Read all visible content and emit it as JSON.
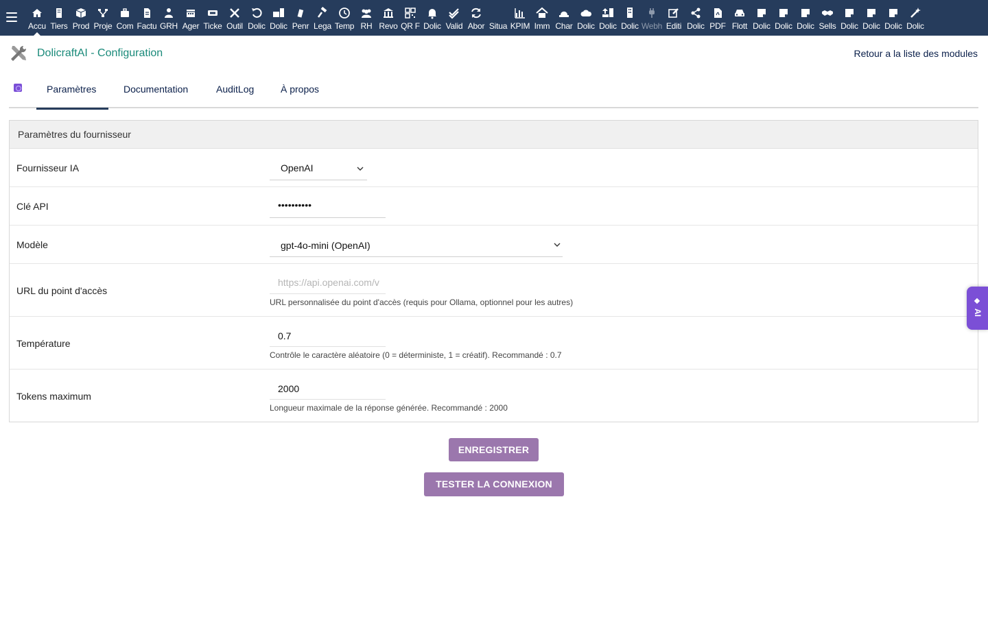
{
  "topbar": {
    "items": [
      {
        "label": "Accu",
        "icon": "home-icon"
      },
      {
        "label": "Tiers",
        "icon": "building-icon"
      },
      {
        "label": "Prod",
        "icon": "cube-icon"
      },
      {
        "label": "Proje",
        "icon": "sitemap-icon"
      },
      {
        "label": "Com",
        "icon": "briefcase-icon"
      },
      {
        "label": "Factu",
        "icon": "invoice-icon"
      },
      {
        "label": "GRH",
        "icon": "users-icon"
      },
      {
        "label": "Ager",
        "icon": "calendar-icon"
      },
      {
        "label": "Ticke",
        "icon": "ticket-icon"
      },
      {
        "label": "Outil",
        "icon": "tools-icon"
      },
      {
        "label": "Dolic",
        "icon": "undo-icon"
      },
      {
        "label": "Dolic",
        "icon": "case-icon"
      },
      {
        "label": "Penr",
        "icon": "note-icon"
      },
      {
        "label": "Lega",
        "icon": "gavel-icon"
      },
      {
        "label": "Temp",
        "icon": "clock-icon"
      },
      {
        "label": "RH",
        "icon": "people-icon"
      },
      {
        "label": "Revo",
        "icon": "bank-icon"
      },
      {
        "label": "QR F",
        "icon": "qrcode-icon"
      },
      {
        "label": "Dolic",
        "icon": "bell-icon"
      },
      {
        "label": "Valid",
        "icon": "check-double-icon"
      },
      {
        "label": "Abor",
        "icon": "sync-icon"
      },
      {
        "label": "Situa",
        "icon": "blank-icon"
      },
      {
        "label": "KPIM",
        "icon": "chart-icon"
      },
      {
        "label": "Imm",
        "icon": "house-icon"
      },
      {
        "label": "Char",
        "icon": "hat-icon"
      },
      {
        "label": "Dolic",
        "icon": "cloud-icon"
      },
      {
        "label": "Dolic",
        "icon": "upload-icon"
      },
      {
        "label": "Dolic",
        "icon": "tower-icon"
      },
      {
        "label": "Webh",
        "icon": "plug-icon"
      },
      {
        "label": "Editi",
        "icon": "edit-icon"
      },
      {
        "label": "Dolic",
        "icon": "share-icon"
      },
      {
        "label": "PDF",
        "icon": "pdf-icon"
      },
      {
        "label": "Flott",
        "icon": "car-icon"
      },
      {
        "label": "Dolic",
        "icon": "sticky-note-icon"
      },
      {
        "label": "Dolic",
        "icon": "sticky-note-icon"
      },
      {
        "label": "Dolic",
        "icon": "sticky-note-icon"
      },
      {
        "label": "Sells",
        "icon": "handshake-icon"
      },
      {
        "label": "Dolic",
        "icon": "sticky-note-icon"
      },
      {
        "label": "Dolic",
        "icon": "sticky-note-icon"
      },
      {
        "label": "Dolic",
        "icon": "sticky-note-icon"
      },
      {
        "label": "Dolic",
        "icon": "magic-icon"
      }
    ]
  },
  "header": {
    "title": "DolicraftAI - Configuration",
    "back_link": "Retour a la liste des modules"
  },
  "tabs": [
    {
      "label": "Paramètres"
    },
    {
      "label": "Documentation"
    },
    {
      "label": "AuditLog"
    },
    {
      "label": "À propos"
    }
  ],
  "form": {
    "section_title": "Paramètres du fournisseur",
    "provider": {
      "label": "Fournisseur IA",
      "value": "OpenAI"
    },
    "api_key": {
      "label": "Clé API",
      "value": "••••••••••"
    },
    "model": {
      "label": "Modèle",
      "value": "gpt-4o-mini (OpenAI)"
    },
    "endpoint": {
      "label": "URL du point d'accès",
      "placeholder": "https://api.openai.com/v",
      "help": "URL personnalisée du point d'accès (requis pour Ollama, optionnel pour les autres)"
    },
    "temperature": {
      "label": "Température",
      "value": "0.7",
      "help": "Contrôle le caractère aléatoire (0 = déterministe, 1 = créatif). Recommandé : 0.7"
    },
    "max_tokens": {
      "label": "Tokens maximum",
      "value": "2000",
      "help": "Longueur maximale de la réponse générée. Recommandé : 2000"
    }
  },
  "buttons": {
    "save": "ENREGISTRER",
    "test": "TESTER LA CONNEXION"
  },
  "ai_tab": {
    "label": "AI"
  },
  "colors": {
    "topbar": "#263c5c",
    "title": "#1a8a7a",
    "button": "#9b77ad",
    "ai_tab": "#7b4fd6"
  }
}
